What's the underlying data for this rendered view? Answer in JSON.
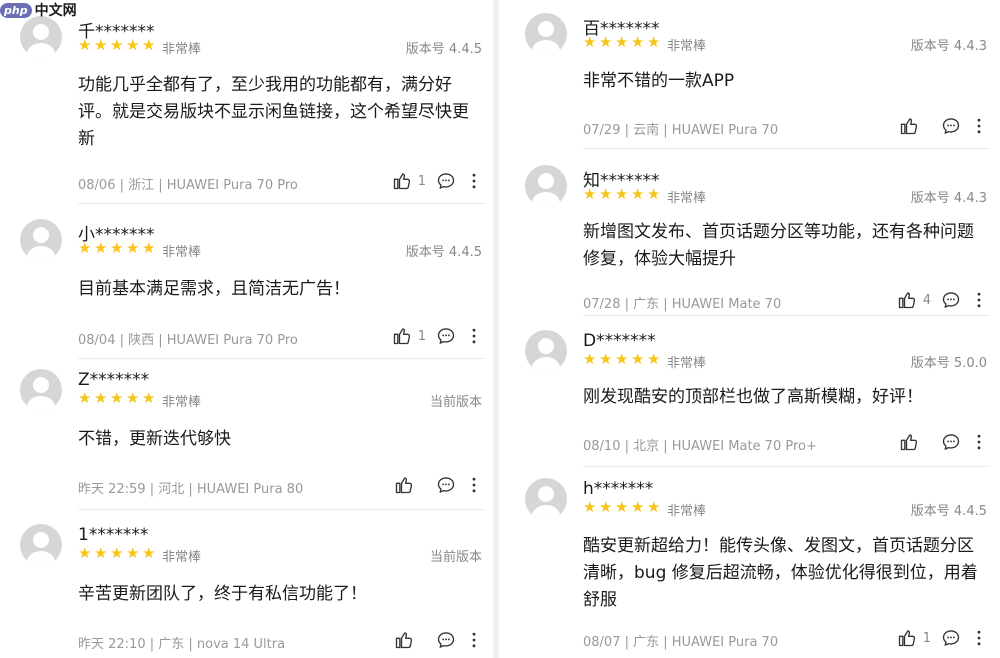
{
  "watermark": {
    "badge": "php",
    "text": "中文网"
  },
  "left": [
    {
      "user": "千*******",
      "rating_label": "非常棒",
      "version": "版本号 4.4.5",
      "content": "功能几乎全都有了，至少我用的功能都有，满分好评。就是交易版块不显示闲鱼链接，这个希望尽快更新",
      "meta": "08/06 | 浙江 | HUAWEI Pura 70 Pro",
      "likes": "1"
    },
    {
      "user": "小*******",
      "rating_label": "非常棒",
      "version": "版本号 4.4.5",
      "content": "目前基本满足需求，且简洁无广告！",
      "meta": "08/04 | 陕西 | HUAWEI Pura 70 Pro",
      "likes": "1"
    },
    {
      "user": "Z*******",
      "rating_label": "非常棒",
      "version": "当前版本",
      "content": "不错，更新迭代够快",
      "meta": "昨天 22:59 | 河北 | HUAWEI Pura 80",
      "likes": ""
    },
    {
      "user": "1*******",
      "rating_label": "非常棒",
      "version": "当前版本",
      "content": "辛苦更新团队了，终于有私信功能了！",
      "meta": "昨天 22:10 | 广东 | nova 14 Ultra",
      "likes": ""
    }
  ],
  "right": [
    {
      "user": "百*******",
      "rating_label": "非常棒",
      "version": "版本号 4.4.3",
      "content": "非常不错的一款APP",
      "meta": "07/29 | 云南 | HUAWEI Pura 70",
      "likes": ""
    },
    {
      "user": "知*******",
      "rating_label": "非常棒",
      "version": "版本号 4.4.3",
      "content": "新增图文发布、首页话题分区等功能，还有各种问题修复，体验大幅提升",
      "meta": "07/28 | 广东 | HUAWEI Mate 70",
      "likes": "4"
    },
    {
      "user": "D*******",
      "rating_label": "非常棒",
      "version": "版本号 5.0.0",
      "content": "刚发现酷安的顶部栏也做了高斯模糊，好评！",
      "meta": "08/10 | 北京 | HUAWEI Mate 70 Pro+",
      "likes": ""
    },
    {
      "user": "h*******",
      "rating_label": "非常棒",
      "version": "版本号 4.4.5",
      "content": "酷安更新超给力！能传头像、发图文，首页话题分区清晰，bug 修复后超流畅，体验优化得很到位，用着舒服",
      "meta": "08/07 | 广东 | HUAWEI Pura 70",
      "likes": "1"
    }
  ],
  "stars_per_review": 5,
  "colors": {
    "star": "#f5c518",
    "meta": "#999999",
    "avatar": "#d6d6d6"
  },
  "icons": [
    "avatar-icon",
    "star-icon",
    "thumbs-up-icon",
    "comment-icon",
    "more-vertical-icon"
  ]
}
